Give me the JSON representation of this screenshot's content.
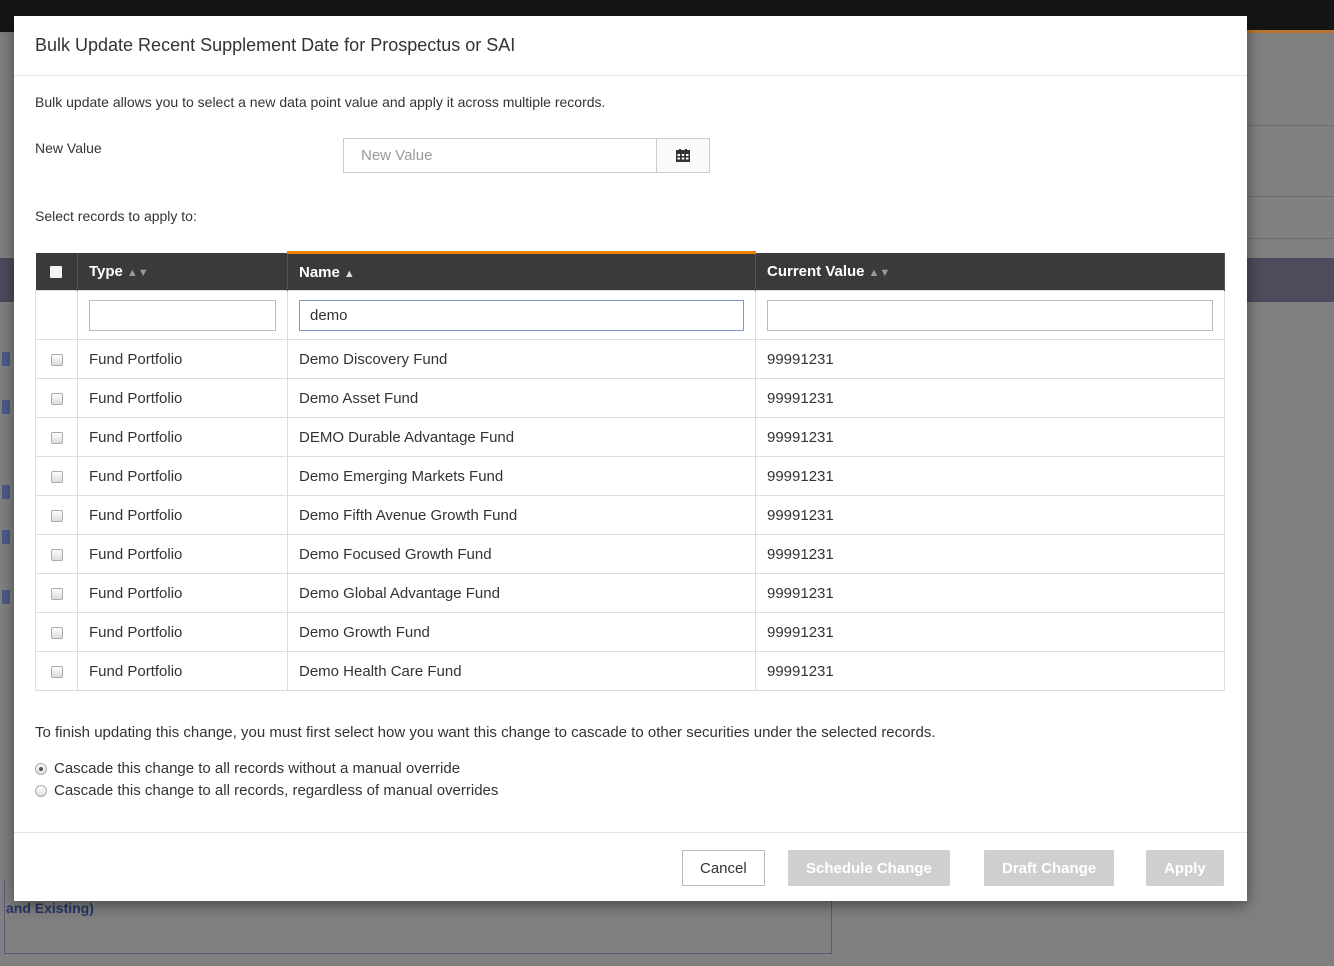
{
  "background": {
    "link_text": "and Existing)"
  },
  "modal": {
    "title": "Bulk Update Recent Supplement Date for Prospectus or SAI",
    "description": "Bulk update allows you to select a new data point value and apply it across multiple records.",
    "new_value": {
      "label": "New Value",
      "placeholder": "New Value",
      "value": "",
      "button_icon": "calendar-icon"
    },
    "select_label": "Select records to apply to:",
    "table": {
      "columns": [
        {
          "label": "Type",
          "sort": "none"
        },
        {
          "label": "Name",
          "sort": "ascending"
        },
        {
          "label": "Current Value",
          "sort": "none"
        }
      ],
      "filters": {
        "type": "",
        "name": "demo",
        "current_value": ""
      },
      "rows": [
        {
          "type": "Fund Portfolio",
          "name": "Demo Discovery Fund",
          "current_value": "99991231",
          "checked": false
        },
        {
          "type": "Fund Portfolio",
          "name": "Demo Asset Fund",
          "current_value": "99991231",
          "checked": false
        },
        {
          "type": "Fund Portfolio",
          "name": "DEMO Durable Advantage Fund",
          "current_value": "99991231",
          "checked": false
        },
        {
          "type": "Fund Portfolio",
          "name": "Demo Emerging Markets Fund",
          "current_value": "99991231",
          "checked": false
        },
        {
          "type": "Fund Portfolio",
          "name": "Demo Fifth Avenue Growth Fund",
          "current_value": "99991231",
          "checked": false
        },
        {
          "type": "Fund Portfolio",
          "name": "Demo Focused Growth Fund",
          "current_value": "99991231",
          "checked": false
        },
        {
          "type": "Fund Portfolio",
          "name": "Demo Global Advantage Fund",
          "current_value": "99991231",
          "checked": false
        },
        {
          "type": "Fund Portfolio",
          "name": "Demo Growth Fund",
          "current_value": "99991231",
          "checked": false
        },
        {
          "type": "Fund Portfolio",
          "name": "Demo Health Care Fund",
          "current_value": "99991231",
          "checked": false
        }
      ]
    },
    "cascade": {
      "note": "To finish updating this change, you must first select how you want this change to cascade to other securities under the selected records.",
      "options": [
        {
          "label": "Cascade this change to all records without a manual override",
          "selected": true
        },
        {
          "label": "Cascade this change to all records, regardless of manual overrides",
          "selected": false
        }
      ]
    },
    "footer": {
      "cancel": "Cancel",
      "schedule": "Schedule Change",
      "draft": "Draft Change",
      "apply": "Apply"
    }
  },
  "colors": {
    "header_bg": "#3a3a3a",
    "sort_accent": "#ef8300",
    "disabled_button": "#cfcfcf"
  }
}
